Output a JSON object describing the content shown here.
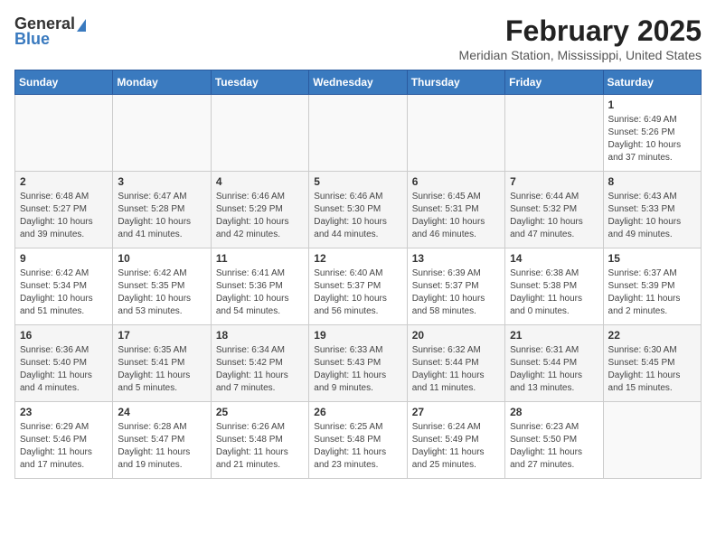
{
  "header": {
    "logo_general": "General",
    "logo_blue": "Blue",
    "title": "February 2025",
    "location": "Meridian Station, Mississippi, United States"
  },
  "days_of_week": [
    "Sunday",
    "Monday",
    "Tuesday",
    "Wednesday",
    "Thursday",
    "Friday",
    "Saturday"
  ],
  "weeks": [
    [
      {
        "day": "",
        "info": ""
      },
      {
        "day": "",
        "info": ""
      },
      {
        "day": "",
        "info": ""
      },
      {
        "day": "",
        "info": ""
      },
      {
        "day": "",
        "info": ""
      },
      {
        "day": "",
        "info": ""
      },
      {
        "day": "1",
        "info": "Sunrise: 6:49 AM\nSunset: 5:26 PM\nDaylight: 10 hours and 37 minutes."
      }
    ],
    [
      {
        "day": "2",
        "info": "Sunrise: 6:48 AM\nSunset: 5:27 PM\nDaylight: 10 hours and 39 minutes."
      },
      {
        "day": "3",
        "info": "Sunrise: 6:47 AM\nSunset: 5:28 PM\nDaylight: 10 hours and 41 minutes."
      },
      {
        "day": "4",
        "info": "Sunrise: 6:46 AM\nSunset: 5:29 PM\nDaylight: 10 hours and 42 minutes."
      },
      {
        "day": "5",
        "info": "Sunrise: 6:46 AM\nSunset: 5:30 PM\nDaylight: 10 hours and 44 minutes."
      },
      {
        "day": "6",
        "info": "Sunrise: 6:45 AM\nSunset: 5:31 PM\nDaylight: 10 hours and 46 minutes."
      },
      {
        "day": "7",
        "info": "Sunrise: 6:44 AM\nSunset: 5:32 PM\nDaylight: 10 hours and 47 minutes."
      },
      {
        "day": "8",
        "info": "Sunrise: 6:43 AM\nSunset: 5:33 PM\nDaylight: 10 hours and 49 minutes."
      }
    ],
    [
      {
        "day": "9",
        "info": "Sunrise: 6:42 AM\nSunset: 5:34 PM\nDaylight: 10 hours and 51 minutes."
      },
      {
        "day": "10",
        "info": "Sunrise: 6:42 AM\nSunset: 5:35 PM\nDaylight: 10 hours and 53 minutes."
      },
      {
        "day": "11",
        "info": "Sunrise: 6:41 AM\nSunset: 5:36 PM\nDaylight: 10 hours and 54 minutes."
      },
      {
        "day": "12",
        "info": "Sunrise: 6:40 AM\nSunset: 5:37 PM\nDaylight: 10 hours and 56 minutes."
      },
      {
        "day": "13",
        "info": "Sunrise: 6:39 AM\nSunset: 5:37 PM\nDaylight: 10 hours and 58 minutes."
      },
      {
        "day": "14",
        "info": "Sunrise: 6:38 AM\nSunset: 5:38 PM\nDaylight: 11 hours and 0 minutes."
      },
      {
        "day": "15",
        "info": "Sunrise: 6:37 AM\nSunset: 5:39 PM\nDaylight: 11 hours and 2 minutes."
      }
    ],
    [
      {
        "day": "16",
        "info": "Sunrise: 6:36 AM\nSunset: 5:40 PM\nDaylight: 11 hours and 4 minutes."
      },
      {
        "day": "17",
        "info": "Sunrise: 6:35 AM\nSunset: 5:41 PM\nDaylight: 11 hours and 5 minutes."
      },
      {
        "day": "18",
        "info": "Sunrise: 6:34 AM\nSunset: 5:42 PM\nDaylight: 11 hours and 7 minutes."
      },
      {
        "day": "19",
        "info": "Sunrise: 6:33 AM\nSunset: 5:43 PM\nDaylight: 11 hours and 9 minutes."
      },
      {
        "day": "20",
        "info": "Sunrise: 6:32 AM\nSunset: 5:44 PM\nDaylight: 11 hours and 11 minutes."
      },
      {
        "day": "21",
        "info": "Sunrise: 6:31 AM\nSunset: 5:44 PM\nDaylight: 11 hours and 13 minutes."
      },
      {
        "day": "22",
        "info": "Sunrise: 6:30 AM\nSunset: 5:45 PM\nDaylight: 11 hours and 15 minutes."
      }
    ],
    [
      {
        "day": "23",
        "info": "Sunrise: 6:29 AM\nSunset: 5:46 PM\nDaylight: 11 hours and 17 minutes."
      },
      {
        "day": "24",
        "info": "Sunrise: 6:28 AM\nSunset: 5:47 PM\nDaylight: 11 hours and 19 minutes."
      },
      {
        "day": "25",
        "info": "Sunrise: 6:26 AM\nSunset: 5:48 PM\nDaylight: 11 hours and 21 minutes."
      },
      {
        "day": "26",
        "info": "Sunrise: 6:25 AM\nSunset: 5:48 PM\nDaylight: 11 hours and 23 minutes."
      },
      {
        "day": "27",
        "info": "Sunrise: 6:24 AM\nSunset: 5:49 PM\nDaylight: 11 hours and 25 minutes."
      },
      {
        "day": "28",
        "info": "Sunrise: 6:23 AM\nSunset: 5:50 PM\nDaylight: 11 hours and 27 minutes."
      },
      {
        "day": "",
        "info": ""
      }
    ]
  ]
}
